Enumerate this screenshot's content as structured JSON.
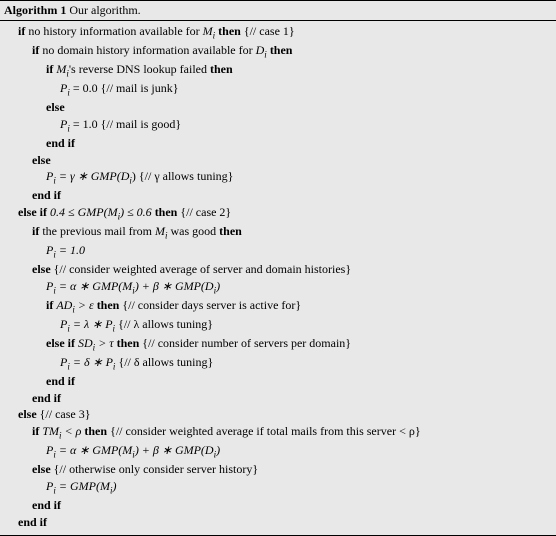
{
  "header": {
    "label": "Algorithm 1",
    "title": " Our algorithm."
  },
  "lines": {
    "l1a": "if ",
    "l1b": "no history information available for ",
    "l1c": "M",
    "l1d": " then ",
    "l1e": "{// case 1}",
    "l2a": "if ",
    "l2b": "no domain history information available for ",
    "l2c": "D",
    "l2d": " then",
    "l3a": "if ",
    "l3b": "M",
    "l3c": "'s reverse DNS lookup failed ",
    "l3d": "then",
    "l4a": "P",
    "l4b": " = 0.0 {// mail is junk}",
    "l5a": "else",
    "l6a": "P",
    "l6b": " = 1.0 {// mail is good}",
    "l7a": "end if",
    "l8a": "else",
    "l9a": "P",
    "l9b": " = γ ∗ GMP(D",
    "l9c": ") {// γ allows tuning}",
    "l10a": "end if",
    "l11a": "else if ",
    "l11b": "0.4 ≤ GMP(M",
    "l11c": ") ≤ 0.6 ",
    "l11d": "then ",
    "l11e": "{// case 2}",
    "l12a": "if ",
    "l12b": "the previous mail from ",
    "l12c": "M",
    "l12d": " was good ",
    "l12e": "then",
    "l13a": "P",
    "l13b": " = 1.0",
    "l14a": "else ",
    "l14b": "{// consider weighted average of server and domain histories}",
    "l15a": "P",
    "l15b": " = α ∗ GMP(M",
    "l15c": ") + β ∗ GMP(D",
    "l15d": ")",
    "l16a": "if ",
    "l16b": "AD",
    "l16c": " > ε ",
    "l16d": "then ",
    "l16e": "{// consider days server is active for}",
    "l17a": "P",
    "l17b": " = λ ∗ P",
    "l17c": " {// λ allows tuning}",
    "l18a": "else if ",
    "l18b": "SD",
    "l18c": " > τ ",
    "l18d": "then ",
    "l18e": "{// consider number of servers per domain}",
    "l19a": "P",
    "l19b": " = δ ∗ P",
    "l19c": " {// δ allows tuning}",
    "l20a": "end if",
    "l21a": "end if",
    "l22a": "else ",
    "l22b": "{// case 3}",
    "l23a": "if ",
    "l23b": "TM",
    "l23c": " < ρ ",
    "l23d": "then ",
    "l23e": "{// consider weighted average if total mails from this server < ρ}",
    "l24a": "P",
    "l24b": " = α ∗ GMP(M",
    "l24c": ") + β ∗ GMP(D",
    "l24d": ")",
    "l25a": "else ",
    "l25b": "{// otherwise only consider server history}",
    "l26a": "P",
    "l26b": " = GMP(M",
    "l26c": ")",
    "l27a": "end if",
    "l28a": "end if",
    "subi": "i"
  }
}
